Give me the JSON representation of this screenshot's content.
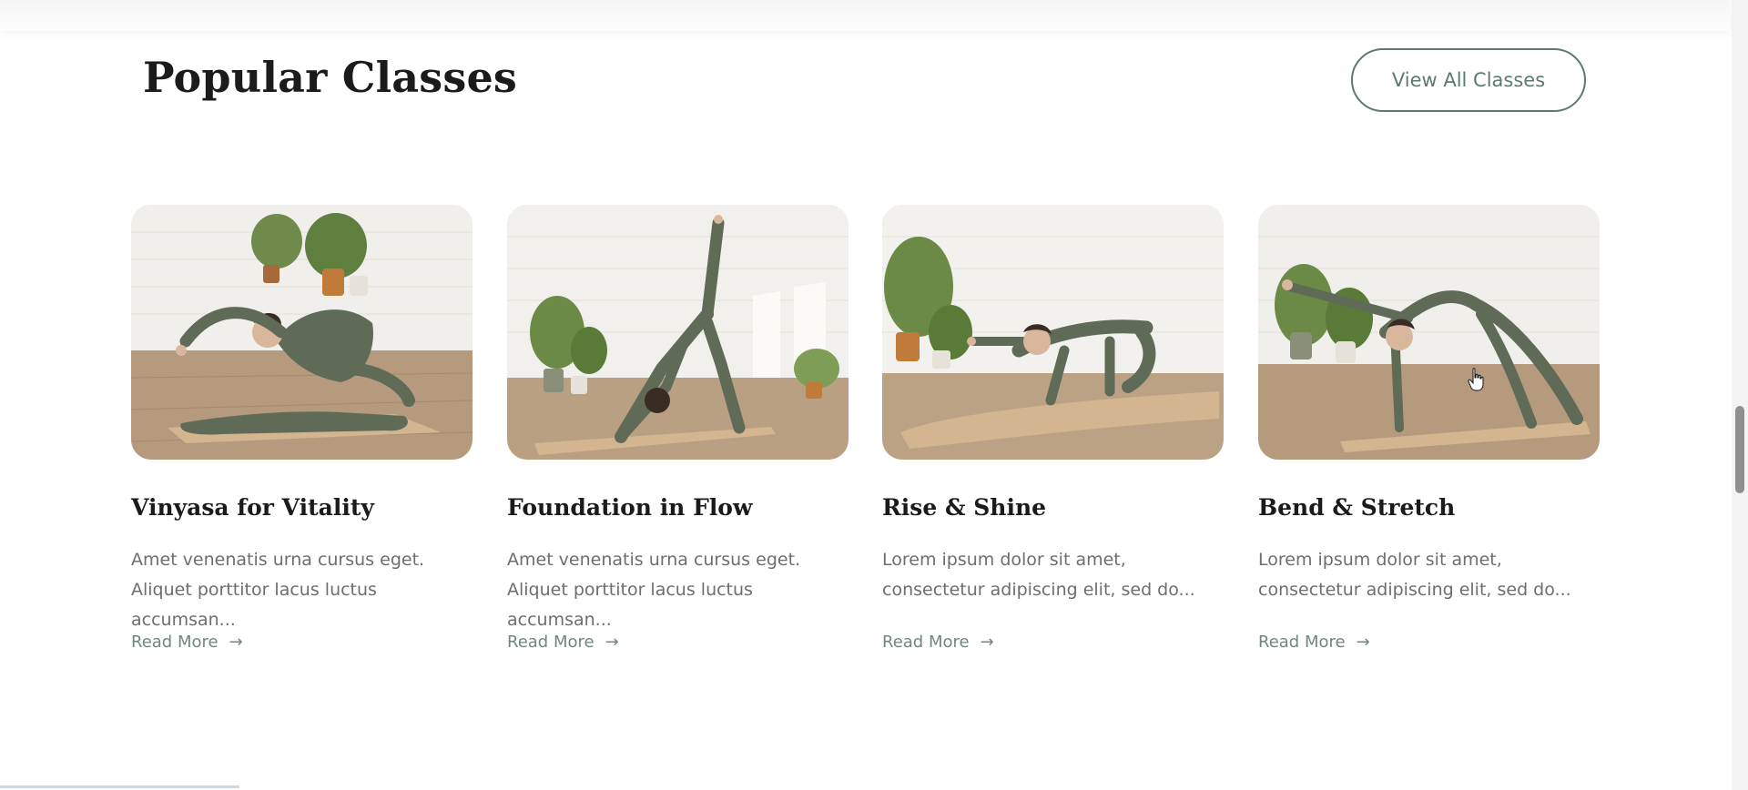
{
  "section": {
    "title": "Popular Classes",
    "view_all_label": "View All Classes"
  },
  "cards": [
    {
      "title": "Vinyasa for Vitality",
      "description": "Amet venenatis urna cursus eget. Aliquet porttitor lacus luctus accumsan...",
      "link_label": "Read More",
      "arrow": "→"
    },
    {
      "title": "Foundation in Flow",
      "description": "Amet venenatis urna cursus eget. Aliquet porttitor lacus luctus accumsan...",
      "link_label": "Read More",
      "arrow": "→"
    },
    {
      "title": "Rise & Shine",
      "description": "Lorem ipsum dolor sit amet, consectetur adipiscing elit, sed do...",
      "link_label": "Read More",
      "arrow": "→"
    },
    {
      "title": "Bend & Stretch",
      "description": "Lorem ipsum dolor sit amet, consectetur adipiscing elit, sed do...",
      "link_label": "Read More",
      "arrow": "→"
    }
  ],
  "colors": {
    "accent": "#5c7a70",
    "link": "#6f8780",
    "heading": "#1b1b1b",
    "body_text": "#6e6e6e",
    "outfit": "#5f6b57",
    "mat": "#d3b590"
  }
}
